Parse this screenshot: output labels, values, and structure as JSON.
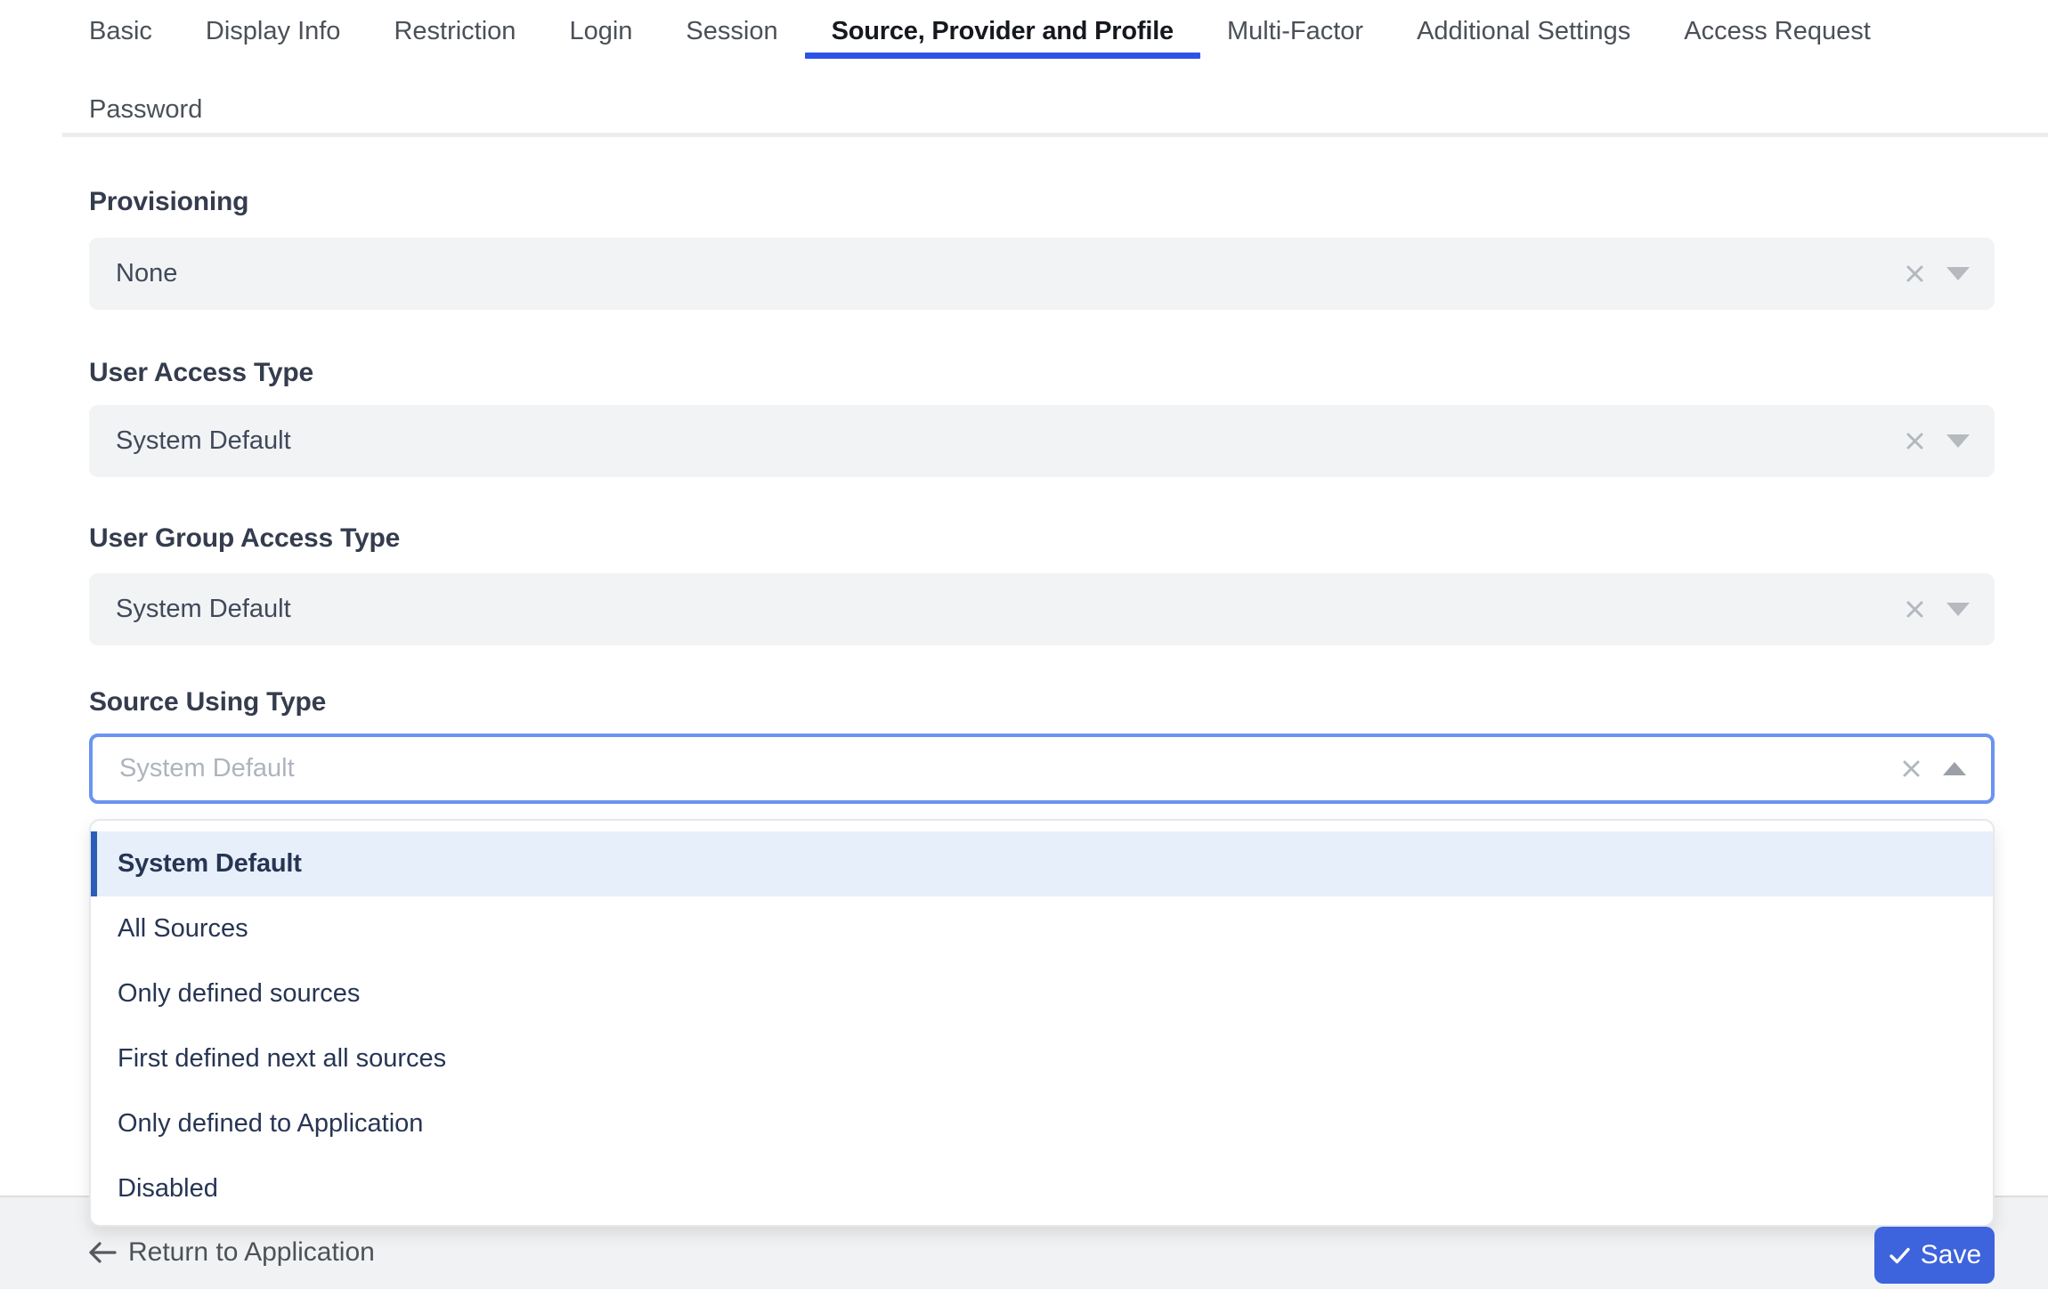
{
  "tabs": {
    "items": [
      {
        "label": "Basic",
        "active": false
      },
      {
        "label": "Display Info",
        "active": false
      },
      {
        "label": "Restriction",
        "active": false
      },
      {
        "label": "Login",
        "active": false
      },
      {
        "label": "Session",
        "active": false
      },
      {
        "label": "Source, Provider and Profile",
        "active": true
      },
      {
        "label": "Multi-Factor",
        "active": false
      },
      {
        "label": "Additional Settings",
        "active": false
      },
      {
        "label": "Access Request",
        "active": false
      },
      {
        "label": "Password",
        "active": false
      }
    ]
  },
  "form": {
    "fields": [
      {
        "label": "Provisioning",
        "value": "None",
        "open": false,
        "icons": [
          "clear-icon",
          "caret-down-icon"
        ]
      },
      {
        "label": "User Access Type",
        "value": "System Default",
        "open": false,
        "icons": [
          "clear-icon",
          "caret-down-icon"
        ]
      },
      {
        "label": "User Group Access Type",
        "value": "System Default",
        "open": false,
        "icons": [
          "clear-icon",
          "caret-down-icon"
        ]
      },
      {
        "label": "Source Using Type",
        "value": "System Default",
        "open": true,
        "icons": [
          "clear-icon",
          "caret-up-icon"
        ]
      }
    ],
    "dropdown": {
      "options": [
        {
          "label": "System Default",
          "selected": true
        },
        {
          "label": "All Sources",
          "selected": false
        },
        {
          "label": "Only defined sources",
          "selected": false
        },
        {
          "label": "First defined next all sources",
          "selected": false
        },
        {
          "label": "Only defined to Application",
          "selected": false
        },
        {
          "label": "Disabled",
          "selected": false
        }
      ]
    }
  },
  "footer": {
    "return_label": "Return to Application",
    "save_label": "Save",
    "icons": [
      "arrow-left-icon",
      "check-icon"
    ]
  },
  "colors": {
    "active_tab_underline": "#2d53e6",
    "save_button": "#3d63dd",
    "focused_select_border": "#6a94ef",
    "selected_option_bg": "#e7f0fa",
    "selected_option_bar": "#2b5cb8"
  },
  "layout_tops": {
    "labels": [
      210,
      402,
      588,
      772
    ],
    "fields": [
      267,
      455,
      644,
      824
    ]
  }
}
